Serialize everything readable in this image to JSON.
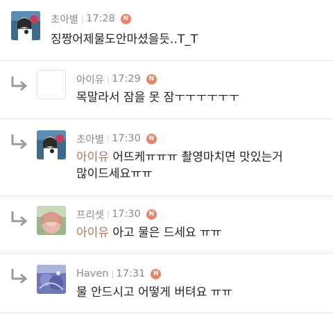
{
  "badge_label": "N",
  "colors": {
    "badge": "#e8846c",
    "mention": "#b07766",
    "meta": "#8a8a8a"
  },
  "comments": [
    {
      "author": "초아별",
      "time": "17:28",
      "mention": "",
      "text": "징짱어제물도안마셨을듯..T_T",
      "text2": ""
    },
    {
      "author": "아이유",
      "time": "17:29",
      "mention": "",
      "text": "목말라서 잠을 못 잠ㅜㅜㅜㅜㅜㅜ",
      "text2": ""
    },
    {
      "author": "초아별",
      "time": "17:30",
      "mention": "아이유",
      "text": " 어뜨케ㅠㅠㅠ 촬영마치면 맛있는거",
      "text2": "많이드세요ㅠㅠ"
    },
    {
      "author": "프리셋",
      "time": "17:30",
      "mention": "아이유",
      "text": " 아고 물은 드세요 ㅠㅠ",
      "text2": ""
    },
    {
      "author": "Haven",
      "time": "17:31",
      "mention": "",
      "text": "물 안드시고 어떻게 버텨요 ㅠㅠ",
      "text2": ""
    }
  ]
}
